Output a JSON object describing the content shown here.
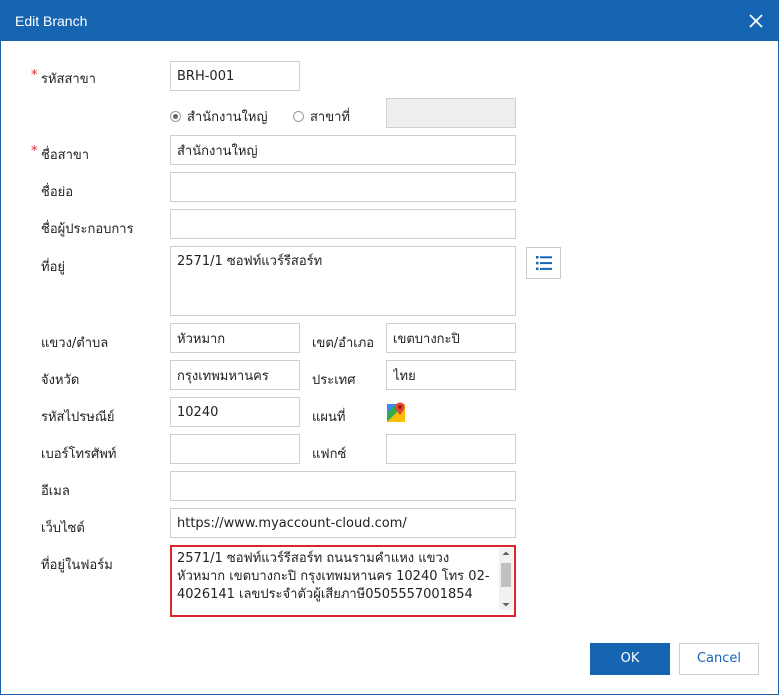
{
  "dialog": {
    "title": "Edit Branch"
  },
  "form": {
    "branch_code": {
      "label": "รหัสสาขา",
      "value": "BRH-001"
    },
    "branch_type": {
      "head_office": "สำนักงานใหญ่",
      "branch_no": "สาขาที่",
      "branch_no_value": "",
      "selected": "head_office"
    },
    "branch_name": {
      "label": "ชื่อสาขา",
      "value": "สำนักงานใหญ่"
    },
    "short_name": {
      "label": "ชื่อย่อ",
      "value": ""
    },
    "operator_name": {
      "label": "ชื่อผู้ประกอบการ",
      "value": ""
    },
    "address": {
      "label": "ที่อยู่",
      "value": "2571/1 ซอฟท์แวร์รีสอร์ท"
    },
    "subdistrict": {
      "label": "แขวง/ตำบล",
      "value": "หัวหมาก"
    },
    "district": {
      "label": "เขต/อำเภอ",
      "value": "เขตบางกะปิ"
    },
    "province": {
      "label": "จังหวัด",
      "value": "กรุงเทพมหานคร"
    },
    "country": {
      "label": "ประเทศ",
      "value": "ไทย"
    },
    "postal_code": {
      "label": "รหัสไปรษณีย์",
      "value": "10240"
    },
    "map": {
      "label": "แผนที่"
    },
    "phone": {
      "label": "เบอร์โทรศัพท์",
      "value": ""
    },
    "fax": {
      "label": "แฟกซ์",
      "value": ""
    },
    "email": {
      "label": "อีเมล",
      "value": ""
    },
    "website": {
      "label": "เว็บไซต์",
      "value": "https://www.myaccount-cloud.com/"
    },
    "form_address": {
      "label": "ที่อยู่ในฟอร์ม",
      "value": "2571/1 ซอฟท์แวร์รีสอร์ท ถนนรามคำแหง แขวงหัวหมาก เขตบางกะปิ กรุงเทพมหานคร 10240 โทร 02-4026141 เลขประจำตัวผู้เสียภาษี0505557001854"
    }
  },
  "buttons": {
    "ok": "OK",
    "cancel": "Cancel"
  },
  "colors": {
    "title_bar": "#1565b3",
    "required": "#d9262e",
    "error_border": "#d9262e",
    "ok_button": "#1565b3"
  },
  "icons": {
    "close": "close-icon",
    "list": "list-icon",
    "map": "google-maps-icon",
    "scroll_up": "chevron-up-icon",
    "scroll_down": "chevron-down-icon"
  }
}
